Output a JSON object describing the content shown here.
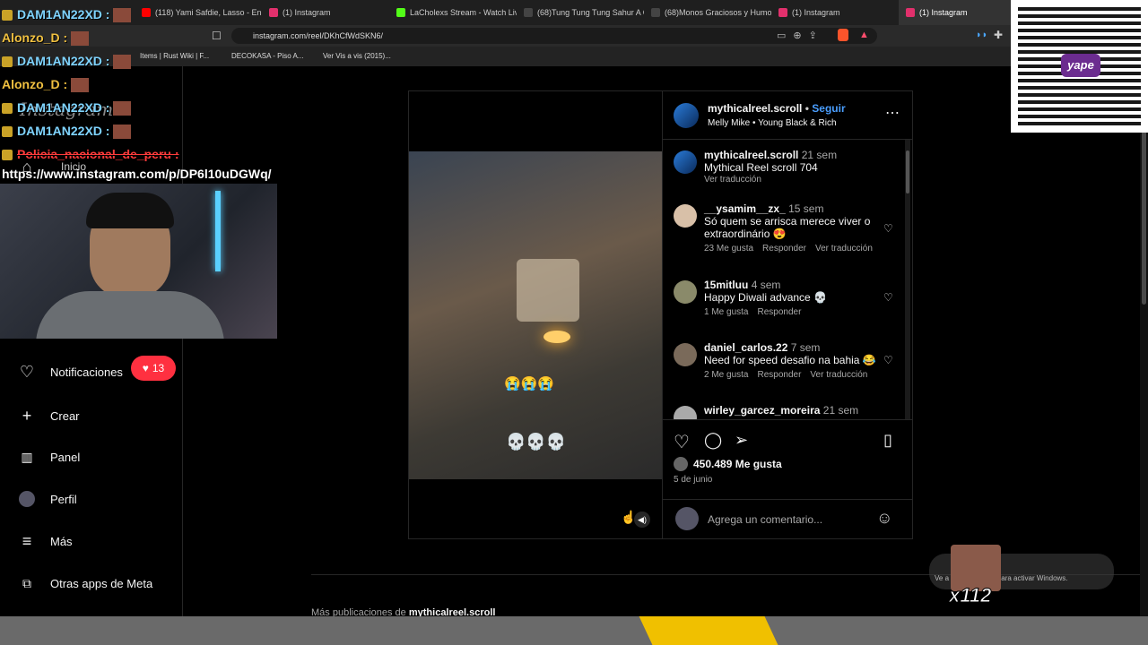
{
  "browser": {
    "tabs": [
      {
        "label": "(118) Yami Safdie, Lasso - En O",
        "color": "#ff0000"
      },
      {
        "label": "(1) Instagram",
        "color": "#e1306c"
      },
      {
        "label": "LaCholexs Stream - Watch Live",
        "color": "#53fc18"
      },
      {
        "label": "(68)Tung Tung Tung Sahur A C",
        "color": "#111111"
      },
      {
        "label": "(68)Monos Graciosos y Humor",
        "color": "#111111"
      },
      {
        "label": "(1) Instagram",
        "color": "#e1306c"
      },
      {
        "label": "(1) Instagram",
        "color": "#e1306c"
      }
    ],
    "url": "instagram.com/reel/DKhCfWdSKN6/",
    "bookmarks": [
      "Items | Rust Wiki | F...",
      "DECOKASA - Piso A...",
      "Ver Vis a vis (2015)..."
    ]
  },
  "chat": [
    {
      "user": "DAM1AN22XD :",
      "color": "#7fd4ff"
    },
    {
      "user": "Alonzo_D :",
      "color": "#f0c040"
    },
    {
      "user": "DAM1AN22XD :",
      "color": "#7fd4ff"
    },
    {
      "user": "Alonzo_D :",
      "color": "#f0c040"
    },
    {
      "user": "DAM1AN22XD :",
      "color": "#7fd4ff"
    },
    {
      "user": "DAM1AN22XD :",
      "color": "#7fd4ff"
    },
    {
      "user": "Policia_nacional_de_peru :",
      "color": "#ff4040"
    }
  ],
  "chat_link": "https://www.instagram.com/p/DP6l10uDGWq/",
  "sidebar": {
    "inicio": "Inicio",
    "items": [
      {
        "label": "Notificaciones",
        "icon": "heart-icon"
      },
      {
        "label": "Crear",
        "icon": "plus-icon"
      },
      {
        "label": "Panel",
        "icon": "chart-icon"
      },
      {
        "label": "Perfil",
        "icon": "avatar"
      },
      {
        "label": "Más",
        "icon": "menu-icon"
      },
      {
        "label": "Otras apps de Meta",
        "icon": "apps-icon"
      }
    ],
    "notif_count": "13"
  },
  "post": {
    "username": "mythicalreel.scroll",
    "follow": "Seguir",
    "audio": "Melly Mike • Young Black & Rich",
    "video_emojis_top": "😭😭😭",
    "video_emojis_bottom": "💀💀💀",
    "comments": [
      {
        "user": "mythicalreel.scroll",
        "time": "21 sem",
        "text": "Mythical Reel scroll 704",
        "meta": [
          "Ver traducción"
        ]
      },
      {
        "user": "__ysamim__zx_",
        "time": "15 sem",
        "text": "Só quem se arrisca merece viver o extraordinário 😍",
        "meta": [
          "23 Me gusta",
          "Responder",
          "Ver traducción"
        ]
      },
      {
        "user": "15mitluu",
        "time": "4 sem",
        "text": "Happy Diwali advance 💀",
        "meta": [
          "1 Me gusta",
          "Responder"
        ]
      },
      {
        "user": "daniel_carlos.22",
        "time": "7 sem",
        "text": "Need for speed desafio na bahia 😂",
        "meta": [
          "2 Me gusta",
          "Responder",
          "Ver traducción"
        ]
      },
      {
        "user": "wirley_garcez_moreira",
        "time": "21 sem",
        "text": "",
        "meta": []
      }
    ],
    "likes": "450.489 Me gusta",
    "date": "5 de junio",
    "comment_placeholder": "Agrega un comentario..."
  },
  "more_posts": {
    "prefix": "Más publicaciones de",
    "user": "mythicalreel.scroll"
  },
  "overlay": {
    "qr_brand": "yape",
    "counter": "x112",
    "windows": "Ve a Configuración para activar Windows."
  }
}
